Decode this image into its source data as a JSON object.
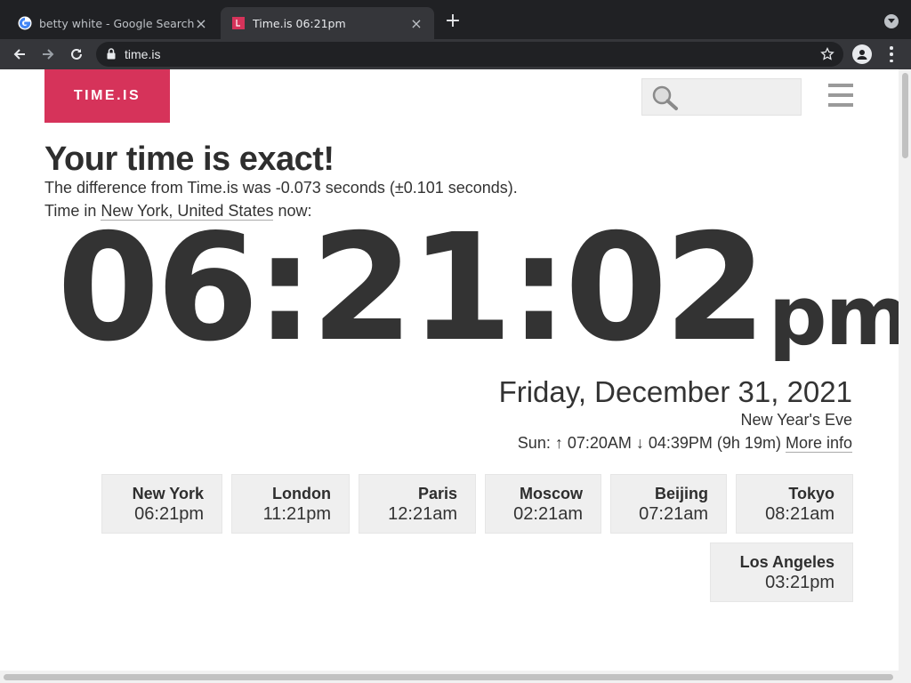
{
  "browser": {
    "tabs": [
      {
        "title": "betty white - Google Search",
        "active": false,
        "favicon": "google-g-icon"
      },
      {
        "title": "Time.is 06:21pm",
        "active": true,
        "favicon": "timeis-icon"
      }
    ],
    "url": "time.is"
  },
  "site": {
    "logo": "TIME.IS",
    "search_placeholder": "",
    "headline": "Your time is exact!",
    "difference": "The difference from Time.is was -0.073 seconds (±0.101 seconds).",
    "location_prefix": "Time in ",
    "location_link": "New York, United States",
    "location_suffix": " now:",
    "time": "06:21:02",
    "ampm": "pm",
    "date": "Friday, December 31, 2021",
    "holiday": "New Year's Eve",
    "sun_text": "Sun: ↑ 07:20AM ↓ 04:39PM (9h 19m) ",
    "more_info": "More info",
    "cities": [
      {
        "name": "New York",
        "time": "06:21pm"
      },
      {
        "name": "London",
        "time": "11:21pm"
      },
      {
        "name": "Paris",
        "time": "12:21am"
      },
      {
        "name": "Moscow",
        "time": "02:21am"
      },
      {
        "name": "Beijing",
        "time": "07:21am"
      },
      {
        "name": "Tokyo",
        "time": "08:21am"
      },
      {
        "name": "Los Angeles",
        "time": "03:21pm"
      }
    ]
  },
  "colors": {
    "brand": "#d6335a",
    "text": "#333333",
    "chrome_dark": "#202124",
    "chrome_toolbar": "#35363a"
  }
}
